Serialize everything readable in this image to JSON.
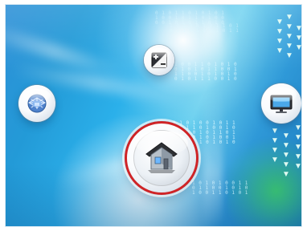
{
  "scene": {
    "binary_lines": [
      "0 1 0 1 1 0 1 0 1 0 1\n1 0 0 1 0 1 1 0 1 0 0\n0 0 1 0 1 0 1 1 0 1 0",
      "1 0 1 0 0 1 0 1 1 0 1\n0 1 1 0 1 0 0 1 0 1 1",
      "1 0 0 1 1 0 1 0 1 0\n0 1 0 1 0 1 1 0 0 1\n1 1 0 0 1 0 1 0 1 0\n0 1 0 1 1 1 0 0 1 0",
      "0 1 0 1 0 0 1 0 1 1\n1 0 1 1 0 1 0 0 1 0\n0 1 0 0 1 0 1 1 0 1\n1 1 1 0 1 0 1 0 0 1\n0 1 0 1 1 0 1 0 1 0",
      "1 0 1 0 1 0 0 1 1\n0 1 1 0 0 1 0 1 0\n1 0 0 1 1 0 1 0 1"
    ],
    "accent_colors": {
      "home_ring": "#cf2427",
      "sky_blue": "#2bb0ea",
      "deep_blue": "#1b79bd",
      "green_glow": "#39c16a"
    }
  },
  "icons": {
    "brightness": "brightness-contrast-icon",
    "network": "network-hub-icon",
    "tv": "television-icon",
    "home": "home-icon"
  }
}
